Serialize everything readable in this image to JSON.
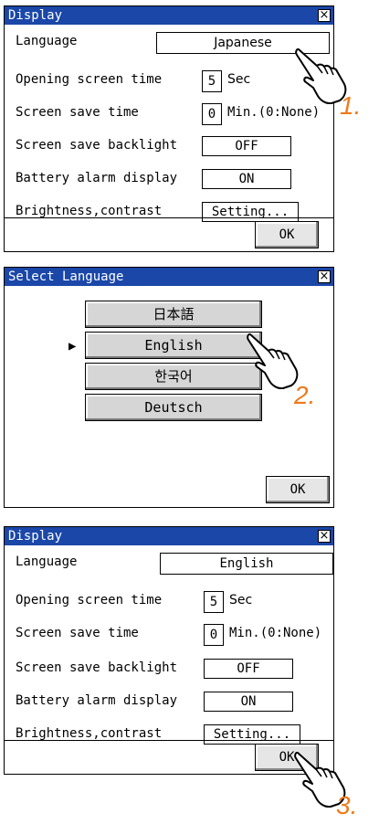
{
  "panel1": {
    "title": "Display",
    "close": "×",
    "rows": {
      "language_label": "Language",
      "language_value": "Japanese",
      "opening_label": "Opening screen time",
      "opening_value": "5",
      "opening_unit": "Sec",
      "screensave_label": "Screen save time",
      "screensave_value": "0",
      "screensave_unit": "Min.(0:None)",
      "backlight_label": "Screen save backlight",
      "backlight_value": "OFF",
      "battery_label": "Battery alarm display",
      "battery_value": "ON",
      "brightness_label": "Brightness,contrast",
      "brightness_value": "Setting..."
    },
    "ok": "OK"
  },
  "panel2": {
    "title": "Select Language",
    "close": "×",
    "languages": [
      "日本語",
      "English",
      "한국어",
      "Deutsch"
    ],
    "selected_marker": "▶",
    "ok": "OK"
  },
  "panel3": {
    "title": "Display",
    "close": "×",
    "rows": {
      "language_label": "Language",
      "language_value": "English",
      "opening_label": "Opening screen time",
      "opening_value": "5",
      "opening_unit": "Sec",
      "screensave_label": "Screen save time",
      "screensave_value": "0",
      "screensave_unit": "Min.(0:None)",
      "backlight_label": "Screen save backlight",
      "backlight_value": "OFF",
      "battery_label": "Battery alarm display",
      "battery_value": "ON",
      "brightness_label": "Brightness,contrast",
      "brightness_value": "Setting..."
    },
    "ok": "OK"
  },
  "steps": [
    "1.",
    "2.",
    "3."
  ],
  "colors": {
    "titlebar": "#1a47a8",
    "step": "#ee7a1a"
  },
  "icons": [
    "close-icon",
    "hand-pointer-icon",
    "selection-arrow-icon"
  ]
}
